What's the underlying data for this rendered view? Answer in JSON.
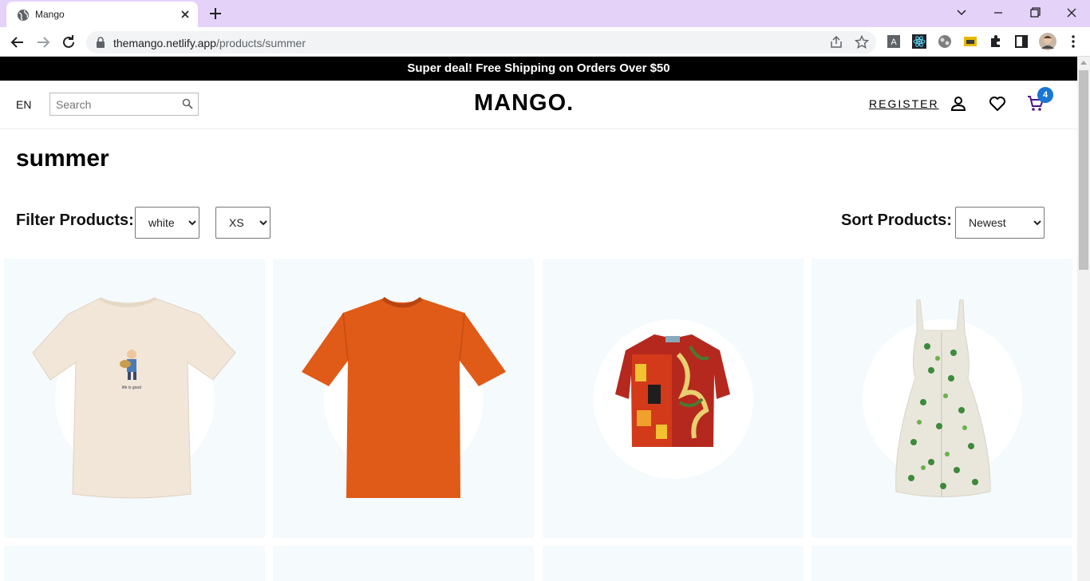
{
  "browser": {
    "tab_title": "Mango",
    "url_host": "themango.netlify.app",
    "url_path": "/products/summer"
  },
  "announcement": "Super deal! Free Shipping on Orders Over $50",
  "navbar": {
    "language": "EN",
    "search_placeholder": "Search",
    "logo": "MANGO.",
    "register_label": "REGISTER",
    "cart_count": "4"
  },
  "page": {
    "title": "summer",
    "filter_label": "Filter Products:",
    "color_filter": {
      "selected": "white"
    },
    "size_filter": {
      "selected": "XS"
    },
    "sort_label": "Sort Products:",
    "sort": {
      "selected": "Newest"
    }
  },
  "products": [
    {
      "name": "cream-tshirt",
      "color": "#f1e6d8"
    },
    {
      "name": "orange-tshirt",
      "color": "#e05a18"
    },
    {
      "name": "tropical-print-shirt",
      "color": "#b5281e"
    },
    {
      "name": "floral-sundress",
      "color": "#e9e6dc"
    }
  ],
  "colors": {
    "tabbar": "#e4d2f8",
    "announcement_bg": "#000000",
    "card_bg": "#f5fafd",
    "badge": "#1976d2"
  }
}
